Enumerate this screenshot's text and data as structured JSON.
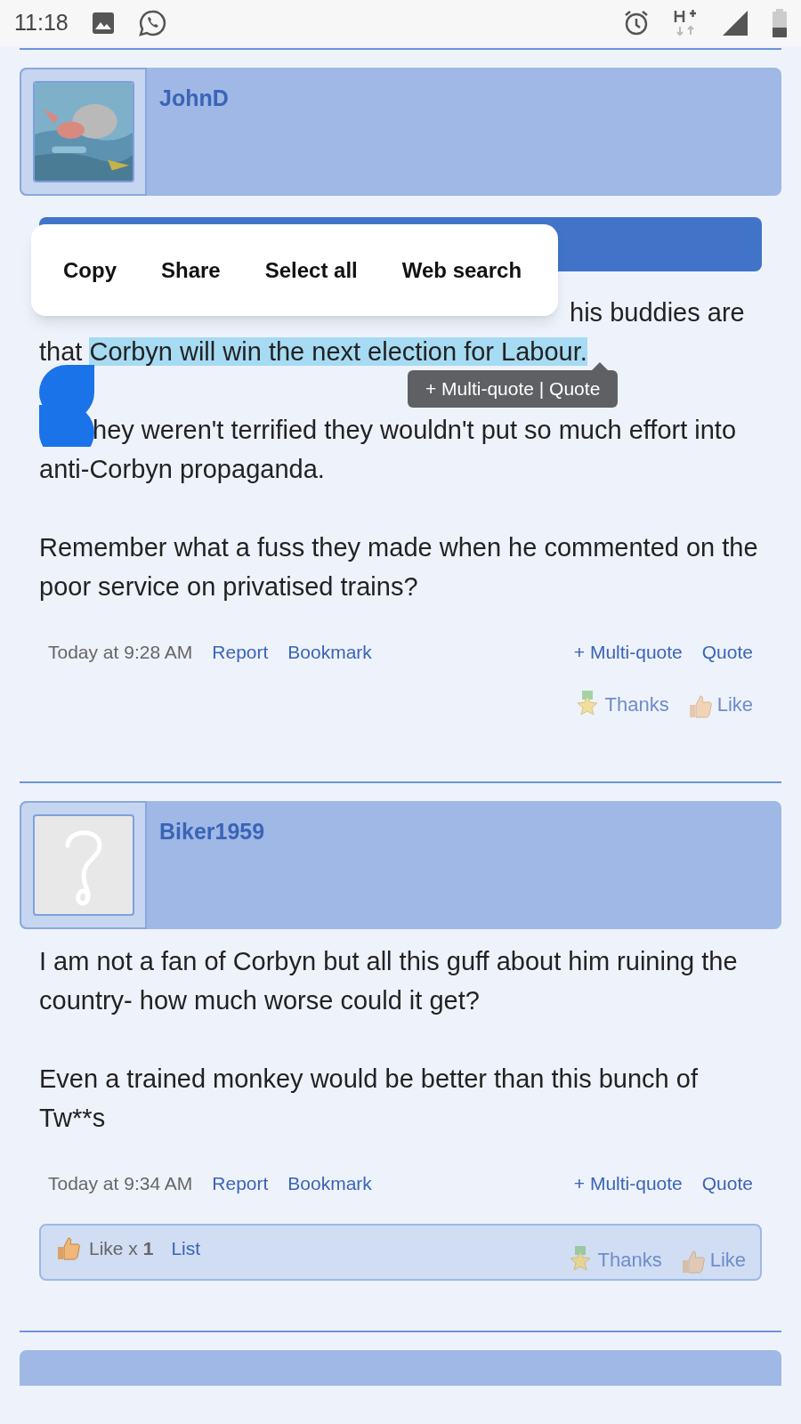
{
  "status_bar": {
    "time": "11:18"
  },
  "context_menu": {
    "items": [
      "Copy",
      "Share",
      "Select all",
      "Web search"
    ]
  },
  "quote_tooltip": {
    "text": "+ Multi-quote | Quote"
  },
  "posts": [
    {
      "author": "JohnD",
      "title_bar": true,
      "body": [
        {
          "kind": "covered",
          "segments": [
            {
              "text": "his buddies are",
              "highlighted": false
            }
          ]
        },
        {
          "kind": "plain",
          "segments": [
            {
              "text": "that ",
              "highlighted": false
            },
            {
              "text": "Corbyn will win the next election for Labour.",
              "highlighted": true
            }
          ]
        },
        {
          "kind": "handle",
          "segments": [
            {
              "text": "hey weren't terrified they wouldn't put so much effort into anti-Corbyn propaganda.",
              "highlighted": false
            }
          ]
        },
        {
          "kind": "plain",
          "segments": [
            {
              "text": "Remember what a fuss they made when he commented on the poor service on privatised trains?",
              "highlighted": false
            }
          ]
        }
      ],
      "time": "Today at 9:28 AM",
      "links": [
        "Report",
        "Bookmark"
      ],
      "quote_links": [
        "+ Multi-quote",
        "Quote"
      ],
      "reactions": [
        "Thanks",
        "Like"
      ]
    },
    {
      "author": "Biker1959",
      "avatar": {
        "kind": "placeholder"
      },
      "title_bar": false,
      "body": [
        {
          "kind": "plain",
          "segments": [
            {
              "text": "I am not a fan of Corbyn but all this guff about him ruining the country- how much worse could it get?",
              "highlighted": false
            }
          ]
        },
        {
          "kind": "plain",
          "segments": [
            {
              "text": "Even a trained monkey would be better than this bunch of Tw**s",
              "highlighted": false
            }
          ]
        }
      ],
      "time": "Today at 9:34 AM",
      "links": [
        "Report",
        "Bookmark"
      ],
      "quote_links": [
        "+ Multi-quote",
        "Quote"
      ],
      "like_summary": {
        "text": "Like x **1**",
        "link": "List"
      },
      "reactions": [
        "Thanks",
        "Like"
      ]
    }
  ]
}
